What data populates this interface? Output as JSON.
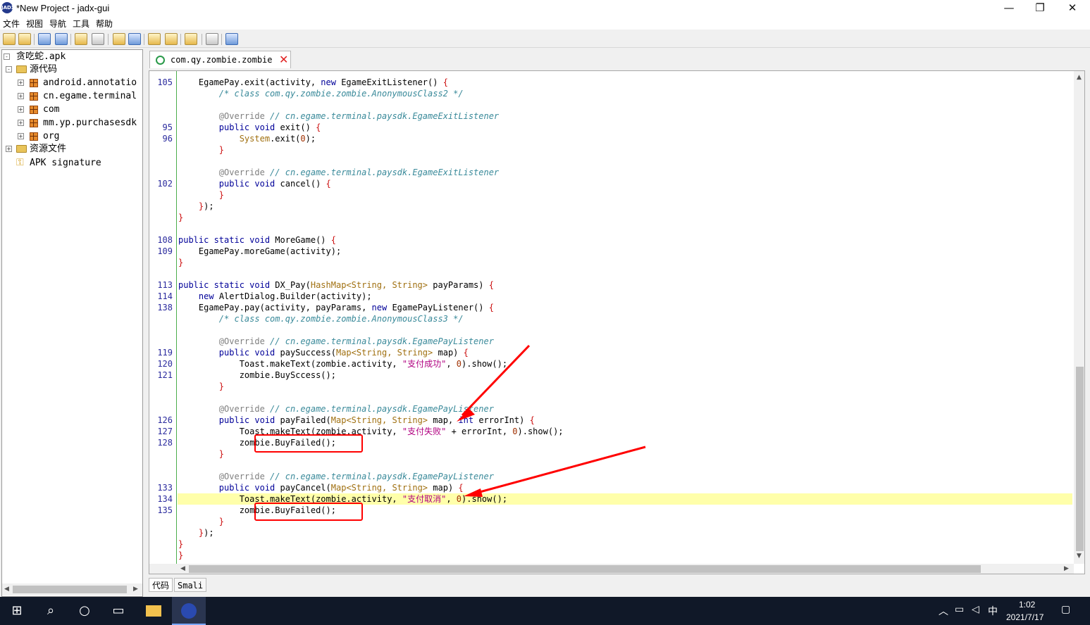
{
  "window": {
    "title": "*New Project - jadx-gui",
    "app_icon_text": "JADX",
    "minimize": "—",
    "maximize": "❐",
    "close": "✕"
  },
  "menu": [
    "文件",
    "视图",
    "导航",
    "工具",
    "帮助"
  ],
  "tree": {
    "root": "贪吃蛇.apk",
    "source_folder": "源代码",
    "packages": [
      "android.annotatio",
      "cn.egame.terminal",
      "com",
      "mm.yp.purchasesdk",
      "org"
    ],
    "resources": "资源文件",
    "signature": "APK signature"
  },
  "editor": {
    "tab_label": "com.qy.zombie.zombie",
    "bottom_tabs": [
      "代码",
      "Smali"
    ],
    "highlight_line": "134",
    "lines": [
      {
        "n": "105",
        "t": [
          [
            "    EgamePay.exit(activity, ",
            ""
          ],
          [
            "new",
            "kw"
          ],
          [
            " EgameExitListener() ",
            ""
          ],
          [
            "{",
            "brc"
          ]
        ]
      },
      {
        "n": "",
        "t": [
          [
            "        /* class com.qy.zombie.zombie.AnonymousClass2 */",
            "cm"
          ]
        ]
      },
      {
        "n": "",
        "t": []
      },
      {
        "n": "",
        "t": [
          [
            "        ",
            ""
          ],
          [
            "@Override",
            "an"
          ],
          [
            " // cn.egame.terminal.paysdk.EgameExitListener",
            "cm"
          ]
        ]
      },
      {
        "n": "95",
        "t": [
          [
            "        ",
            ""
          ],
          [
            "public void",
            "kw"
          ],
          [
            " exit() ",
            ""
          ],
          [
            "{",
            "brc"
          ]
        ]
      },
      {
        "n": "96",
        "t": [
          [
            "            ",
            ""
          ],
          [
            "System",
            "gen"
          ],
          [
            ".exit(",
            ""
          ],
          [
            "0",
            "num"
          ],
          [
            ");",
            ""
          ]
        ]
      },
      {
        "n": "",
        "t": [
          [
            "        ",
            ""
          ],
          [
            "}",
            "brc"
          ]
        ]
      },
      {
        "n": "",
        "t": []
      },
      {
        "n": "",
        "t": [
          [
            "        ",
            ""
          ],
          [
            "@Override",
            "an"
          ],
          [
            " // cn.egame.terminal.paysdk.EgameExitListener",
            "cm"
          ]
        ]
      },
      {
        "n": "102",
        "t": [
          [
            "        ",
            ""
          ],
          [
            "public void",
            "kw"
          ],
          [
            " cancel() ",
            ""
          ],
          [
            "{",
            "brc"
          ]
        ]
      },
      {
        "n": "",
        "t": [
          [
            "        ",
            ""
          ],
          [
            "}",
            "brc"
          ]
        ]
      },
      {
        "n": "",
        "t": [
          [
            "    ",
            ""
          ],
          [
            "}",
            "brc"
          ],
          [
            ");",
            ""
          ]
        ]
      },
      {
        "n": "",
        "t": [
          [
            "}",
            "brc"
          ]
        ]
      },
      {
        "n": "",
        "t": []
      },
      {
        "n": "108",
        "t": [
          [
            "",
            ""
          ],
          [
            "public static void",
            "kw"
          ],
          [
            " MoreGame() ",
            ""
          ],
          [
            "{",
            "brc"
          ]
        ]
      },
      {
        "n": "109",
        "t": [
          [
            "    EgamePay.moreGame(activity);",
            ""
          ]
        ]
      },
      {
        "n": "",
        "t": [
          [
            "}",
            "brc"
          ]
        ]
      },
      {
        "n": "",
        "t": []
      },
      {
        "n": "113",
        "t": [
          [
            "",
            ""
          ],
          [
            "public static void",
            "kw"
          ],
          [
            " DX_Pay(",
            ""
          ],
          [
            "HashMap<String, String>",
            "gen"
          ],
          [
            " payParams) ",
            ""
          ],
          [
            "{",
            "brc"
          ]
        ]
      },
      {
        "n": "114",
        "t": [
          [
            "    ",
            ""
          ],
          [
            "new",
            "kw"
          ],
          [
            " AlertDialog.Builder(activity);",
            ""
          ]
        ]
      },
      {
        "n": "138",
        "t": [
          [
            "    EgamePay.pay(activity, payParams, ",
            ""
          ],
          [
            "new",
            "kw"
          ],
          [
            " EgamePayListener() ",
            ""
          ],
          [
            "{",
            "brc"
          ]
        ]
      },
      {
        "n": "",
        "t": [
          [
            "        /* class com.qy.zombie.zombie.AnonymousClass3 */",
            "cm"
          ]
        ]
      },
      {
        "n": "",
        "t": []
      },
      {
        "n": "",
        "t": [
          [
            "        ",
            ""
          ],
          [
            "@Override",
            "an"
          ],
          [
            " // cn.egame.terminal.paysdk.EgamePayListener",
            "cm"
          ]
        ]
      },
      {
        "n": "119",
        "t": [
          [
            "        ",
            ""
          ],
          [
            "public void",
            "kw"
          ],
          [
            " paySuccess(",
            ""
          ],
          [
            "Map<String, String>",
            "gen"
          ],
          [
            " map) ",
            ""
          ],
          [
            "{",
            "brc"
          ]
        ]
      },
      {
        "n": "120",
        "t": [
          [
            "            Toast.makeText(zombie.activity, ",
            ""
          ],
          [
            "\"支付成功\"",
            "str"
          ],
          [
            ", ",
            ""
          ],
          [
            "0",
            "num"
          ],
          [
            ").show();",
            ""
          ]
        ]
      },
      {
        "n": "121",
        "t": [
          [
            "            zombie.BuySccess();",
            ""
          ]
        ]
      },
      {
        "n": "",
        "t": [
          [
            "        ",
            ""
          ],
          [
            "}",
            "brc"
          ]
        ]
      },
      {
        "n": "",
        "t": []
      },
      {
        "n": "",
        "t": [
          [
            "        ",
            ""
          ],
          [
            "@Override",
            "an"
          ],
          [
            " // cn.egame.terminal.paysdk.EgamePayListener",
            "cm"
          ]
        ]
      },
      {
        "n": "126",
        "t": [
          [
            "        ",
            ""
          ],
          [
            "public void",
            "kw"
          ],
          [
            " payFailed(",
            ""
          ],
          [
            "Map<String, String>",
            "gen"
          ],
          [
            " map, ",
            ""
          ],
          [
            "int",
            "kw"
          ],
          [
            " errorInt) ",
            ""
          ],
          [
            "{",
            "brc"
          ]
        ]
      },
      {
        "n": "127",
        "t": [
          [
            "            Toast.makeText(zombie.activity, ",
            ""
          ],
          [
            "\"支付失败\"",
            "str"
          ],
          [
            " + errorInt, ",
            ""
          ],
          [
            "0",
            "num"
          ],
          [
            ").show();",
            ""
          ]
        ]
      },
      {
        "n": "128",
        "t": [
          [
            "            zombie.BuyFailed();",
            ""
          ]
        ]
      },
      {
        "n": "",
        "t": [
          [
            "        ",
            ""
          ],
          [
            "}",
            "brc"
          ]
        ]
      },
      {
        "n": "",
        "t": []
      },
      {
        "n": "",
        "t": [
          [
            "        ",
            ""
          ],
          [
            "@Override",
            "an"
          ],
          [
            " // cn.egame.terminal.paysdk.EgamePayListener",
            "cm"
          ]
        ]
      },
      {
        "n": "133",
        "t": [
          [
            "        ",
            ""
          ],
          [
            "public void",
            "kw"
          ],
          [
            " payCancel(",
            ""
          ],
          [
            "Map<String, String>",
            "gen"
          ],
          [
            " map) ",
            ""
          ],
          [
            "{",
            "brc"
          ]
        ]
      },
      {
        "n": "134",
        "t": [
          [
            "            Toast.makeText(zombie.activity, ",
            ""
          ],
          [
            "\"支付取消\"",
            "str"
          ],
          [
            ", ",
            ""
          ],
          [
            "0",
            "num"
          ],
          [
            ").show();",
            ""
          ]
        ]
      },
      {
        "n": "135",
        "t": [
          [
            "            zombie.BuyFailed();",
            ""
          ]
        ]
      },
      {
        "n": "",
        "t": [
          [
            "        ",
            ""
          ],
          [
            "}",
            "brc"
          ]
        ]
      },
      {
        "n": "",
        "t": [
          [
            "    ",
            ""
          ],
          [
            "}",
            "brc"
          ],
          [
            ");",
            ""
          ]
        ]
      },
      {
        "n": "",
        "t": [
          [
            "}",
            "brc"
          ]
        ]
      },
      {
        "n": "",
        "t": [
          [
            "}",
            "brc"
          ]
        ]
      }
    ]
  },
  "taskbar": {
    "time": "1:02",
    "date": "2021/7/17",
    "ime": "中"
  },
  "colors": {
    "annotation_red": "#ff0000",
    "line_highlight": "#ffffaa",
    "gutter_green": "#4cae4c"
  }
}
